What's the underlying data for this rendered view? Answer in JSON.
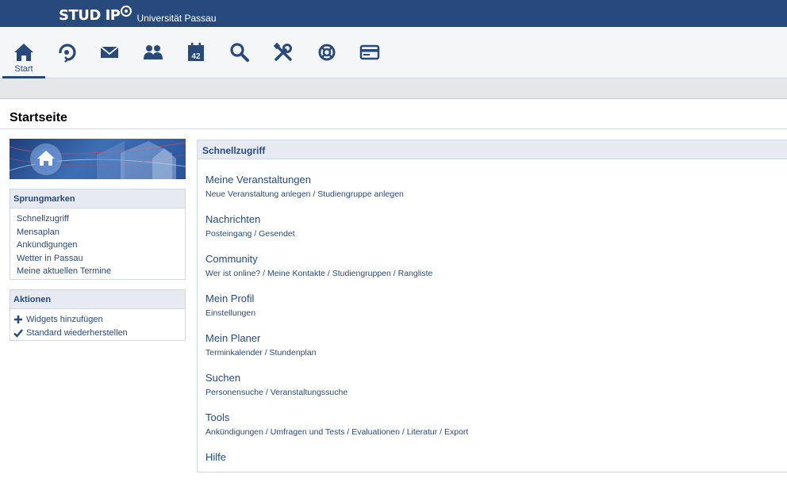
{
  "brand": {
    "logo_text": "STUD IP",
    "university": "Universität Passau"
  },
  "nav": {
    "items": [
      {
        "icon": "home-icon",
        "label": "Start"
      },
      {
        "icon": "courses-icon",
        "label": ""
      },
      {
        "icon": "mail-icon",
        "label": ""
      },
      {
        "icon": "community-icon",
        "label": ""
      },
      {
        "icon": "calendar-icon",
        "label": ""
      },
      {
        "icon": "search-icon",
        "label": ""
      },
      {
        "icon": "tools-icon",
        "label": ""
      },
      {
        "icon": "help-icon",
        "label": ""
      },
      {
        "icon": "card-icon",
        "label": ""
      }
    ],
    "calendar_day": "42"
  },
  "page": {
    "title": "Startseite"
  },
  "sidebar": {
    "jump": {
      "title": "Sprungmarken",
      "links": [
        "Schnellzugriff",
        "Mensaplan",
        "Ankündigungen",
        "Wetter in Passau",
        "Meine aktuellen Termine"
      ]
    },
    "actions": {
      "title": "Aktionen",
      "items": [
        "Widgets hinzufügen",
        "Standard wiederherstellen"
      ]
    }
  },
  "quickaccess": {
    "title": "Schnellzugriff",
    "items": [
      {
        "title": "Meine Veranstaltungen",
        "sub": "Neue Veranstaltung anlegen / Studiengruppe anlegen"
      },
      {
        "title": "Nachrichten",
        "sub": "Posteingang / Gesendet"
      },
      {
        "title": "Community",
        "sub": "Wer ist online? / Meine Kontakte / Studiengruppen / Rangliste"
      },
      {
        "title": "Mein Profil",
        "sub": "Einstellungen"
      },
      {
        "title": "Mein Planer",
        "sub": "Terminkalender / Stundenplan"
      },
      {
        "title": "Suchen",
        "sub": "Personensuche / Veranstaltungssuche"
      },
      {
        "title": "Tools",
        "sub": "Ankündigungen / Umfragen und Tests / Evaluationen / Literatur / Export"
      },
      {
        "title": "Hilfe",
        "sub": ""
      }
    ]
  },
  "colors": {
    "brand": "#28497c",
    "panel_header": "#e7ebf1",
    "border": "#d0d7e3"
  }
}
